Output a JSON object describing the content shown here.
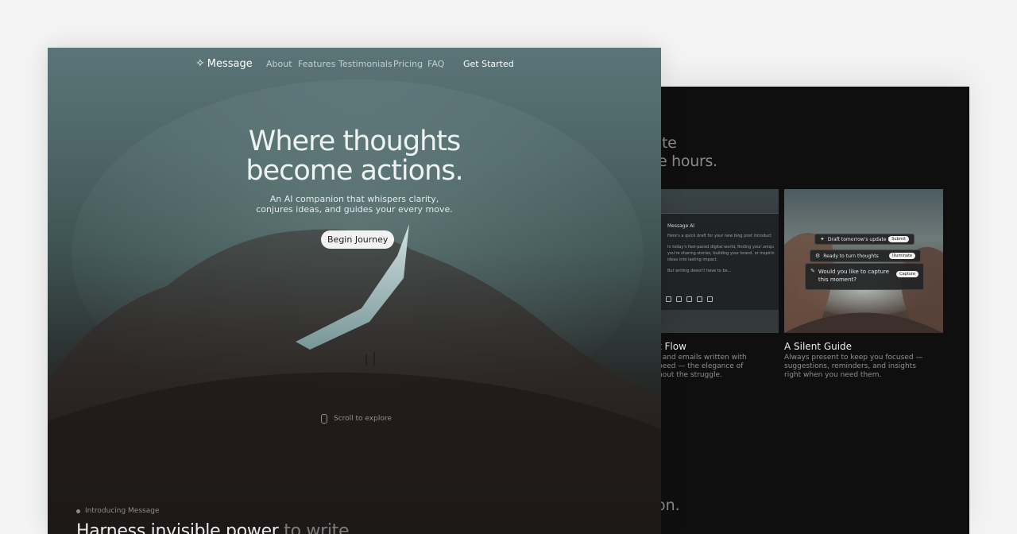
{
  "back": {
    "heading_lines": [
      "ite",
      "e hours."
    ],
    "ai_panel": {
      "title": "Message AI",
      "lines": [
        "Here's a quick draft for your new blog post introduct",
        "In today's fast-paced digital world, finding your uniqu",
        "you're sharing stories, building your brand, or inspirin",
        "ideas into lasting impact.",
        "But writing doesn't have to be..."
      ]
    },
    "pills": [
      {
        "text": "Draft tomorrow's update in",
        "button": "Submit",
        "icon": "sparkle-icon"
      },
      {
        "text": "Ready to turn thoughts",
        "button": "Illuminate",
        "icon": "gear-icon"
      },
      {
        "text": "Would you like to capture this moment?",
        "button": "Capture",
        "icon": "pen-icon"
      }
    ],
    "cards": [
      {
        "title": "t Flow",
        "desc": [
          ", and emails written with",
          "peed — the elegance of",
          "hout the struggle."
        ]
      },
      {
        "title": "A Silent Guide",
        "desc": [
          "Always present to keep you focused —",
          "suggestions, reminders, and insights",
          "right when you need them."
        ]
      }
    ],
    "bottom_text": "on."
  },
  "front": {
    "nav": {
      "brand": "Message",
      "links": [
        "About",
        "Features",
        "Testimonials",
        "Pricing",
        "FAQ"
      ],
      "cta": "Get Started"
    },
    "hero": {
      "title_lines": [
        "Where thoughts",
        "become actions."
      ],
      "subtitle_lines": [
        "An AI companion that whispers clarity,",
        "conjures ideas, and guides your every move."
      ],
      "button": "Begin Journey"
    },
    "scroll_hint": "Scroll to explore",
    "intro_label": "Introducing Message",
    "section_heading": {
      "main": "Harness invisible power",
      "muted": " to write"
    }
  }
}
